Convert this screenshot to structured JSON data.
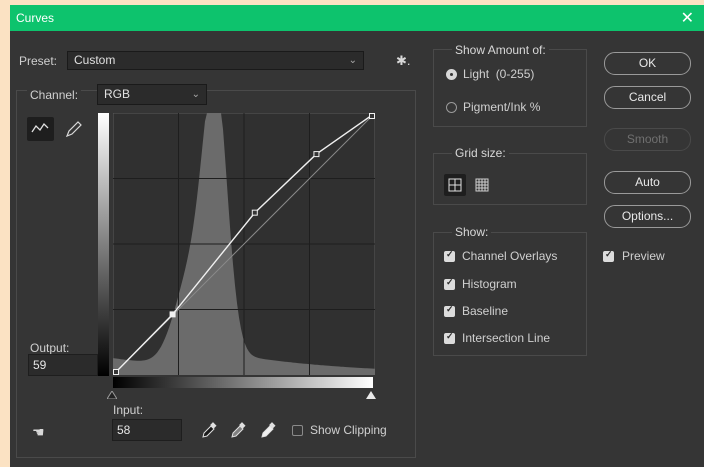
{
  "window": {
    "title": "Curves",
    "close_glyph": "✕"
  },
  "preset": {
    "label": "Preset:",
    "value": "Custom"
  },
  "channel": {
    "label": "Channel:",
    "value": "RGB"
  },
  "output": {
    "label": "Output:",
    "value": "59"
  },
  "input": {
    "label": "Input:",
    "value": "58"
  },
  "show_clipping": {
    "label": "Show Clipping",
    "checked": false
  },
  "show_amount": {
    "legend": "Show Amount of:",
    "options": [
      {
        "label": "Light  (0-255)",
        "selected": true
      },
      {
        "label": "Pigment/Ink %",
        "selected": false
      }
    ]
  },
  "grid_size": {
    "legend": "Grid size:"
  },
  "show": {
    "legend": "Show:",
    "items": [
      {
        "label": "Channel Overlays",
        "checked": true
      },
      {
        "label": "Histogram",
        "checked": true
      },
      {
        "label": "Baseline",
        "checked": true
      },
      {
        "label": "Intersection Line",
        "checked": true
      }
    ]
  },
  "buttons": {
    "ok": "OK",
    "cancel": "Cancel",
    "smooth": "Smooth",
    "auto": "Auto",
    "options": "Options..."
  },
  "preview": {
    "label": "Preview",
    "checked": true
  },
  "curve": {
    "points": [
      [
        0,
        0
      ],
      [
        58,
        59
      ],
      [
        138,
        158
      ],
      [
        198,
        215
      ],
      [
        255,
        255
      ]
    ],
    "selected_point": [
      58,
      59
    ]
  },
  "colors": {
    "titlebar": "#0dc36d",
    "panel": "#353535"
  }
}
